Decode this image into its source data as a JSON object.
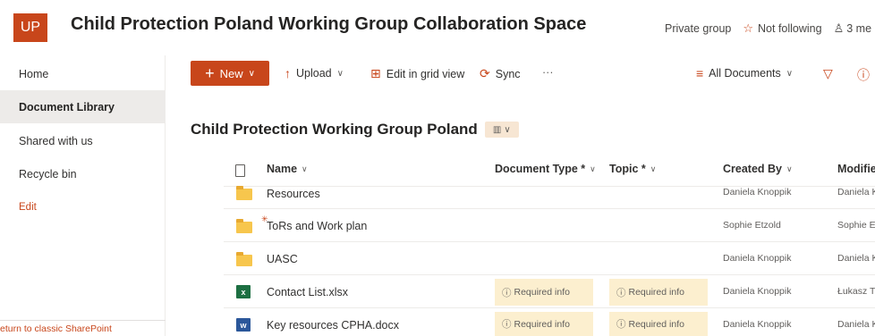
{
  "header": {
    "logo_text": "UP",
    "site_title": "Child Protection Poland Working Group Collaboration Space",
    "privacy": "Private group",
    "follow_label": "Not following",
    "members": "3 me"
  },
  "leftnav": {
    "items": [
      {
        "label": "Home"
      },
      {
        "label": "Document Library"
      },
      {
        "label": "Shared with us"
      },
      {
        "label": "Recycle bin"
      }
    ],
    "edit_label": "Edit",
    "classic_link": "eturn to classic SharePoint"
  },
  "cmdbar": {
    "new_label": "New",
    "upload_label": "Upload",
    "grid_label": "Edit in grid view",
    "sync_label": "Sync",
    "more_label": "···",
    "view_label": "All Documents"
  },
  "library": {
    "title": "Child Protection Working Group Poland"
  },
  "table": {
    "columns": {
      "name": "Name",
      "doc_type": "Document Type *",
      "topic": "Topic *",
      "created_by": "Created By",
      "modified_by": "Modifie"
    },
    "required_text": "Required info",
    "rows": [
      {
        "name": "Resources",
        "type": "folder",
        "created_by": "Daniela Knoppik",
        "modified_by": "Daniela K",
        "required": false
      },
      {
        "name": "ToRs and Work plan",
        "type": "folder",
        "is_new": true,
        "created_by": "Sophie Etzold",
        "modified_by": "Sophie E",
        "required": false
      },
      {
        "name": "UASC",
        "type": "folder",
        "created_by": "Daniela Knoppik",
        "modified_by": "Daniela K",
        "required": false
      },
      {
        "name": "Contact List.xlsx",
        "type": "excel",
        "created_by": "Daniela Knoppik",
        "modified_by": "Łukasz T",
        "required": true
      },
      {
        "name": "Key resources CPHA.docx",
        "type": "word",
        "created_by": "Daniela Knoppik",
        "modified_by": "Daniela K",
        "required": true
      }
    ]
  },
  "colors": {
    "accent": "#c8461b",
    "required_bg": "#fcefcf",
    "selected_nav": "#edebe9"
  }
}
